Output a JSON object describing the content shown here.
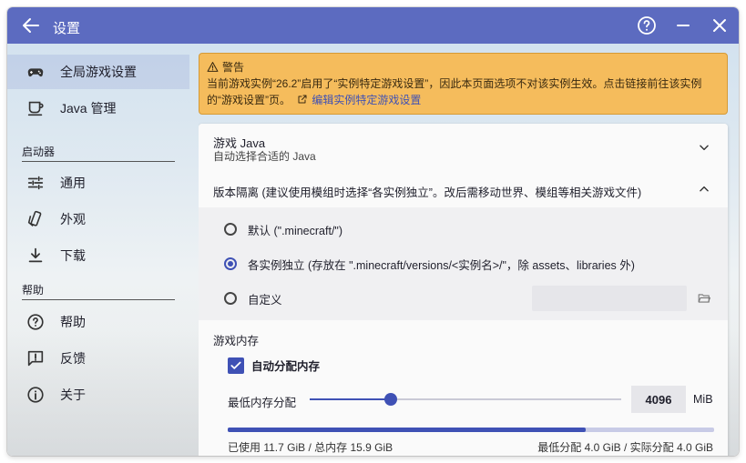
{
  "window": {
    "title": "设置"
  },
  "sidebar": {
    "items": [
      {
        "label": "全局游戏设置",
        "icon": "gamepad-icon"
      },
      {
        "label": "Java 管理",
        "icon": "cup-icon"
      }
    ],
    "sections": [
      {
        "title": "启动器",
        "items": [
          {
            "label": "通用",
            "icon": "sliders-icon"
          },
          {
            "label": "外观",
            "icon": "palette-icon"
          },
          {
            "label": "下载",
            "icon": "download-icon"
          }
        ]
      },
      {
        "title": "帮助",
        "items": [
          {
            "label": "帮助",
            "icon": "help-icon"
          },
          {
            "label": "反馈",
            "icon": "feedback-icon"
          },
          {
            "label": "关于",
            "icon": "info-icon"
          }
        ]
      }
    ]
  },
  "warning": {
    "title": "警告",
    "body": "当前游戏实例“26.2”启用了“实例特定游戏设置”，因此本页面选项不对该实例生效。点击链接前往该实例的“游戏设置”页。",
    "link": "编辑实例特定游戏设置"
  },
  "java": {
    "title": "游戏 Java",
    "subtitle": "自动选择合适的 Java"
  },
  "isolation": {
    "title": "版本隔离 (建议使用模组时选择“各实例独立”。改后需移动世界、模组等相关游戏文件)",
    "options": [
      {
        "label": "默认 (\".minecraft/\")",
        "selected": false
      },
      {
        "label": "各实例独立 (存放在 \".minecraft/versions/<实例名>/\"，除 assets、libraries 外)",
        "selected": true
      },
      {
        "label": "自定义",
        "selected": false
      }
    ]
  },
  "memory": {
    "title": "游戏内存",
    "auto_label": "自动分配内存",
    "auto_checked": true,
    "min_label": "最低内存分配",
    "min_value": "4096",
    "slider_fraction": 0.26,
    "unit": "MiB",
    "usage_fraction": 0.736,
    "usage_left": "已使用 11.7 GiB / 总内存 15.9 GiB",
    "usage_right": "最低分配 4.0 GiB / 实际分配 4.0 GiB"
  },
  "colors": {
    "accent": "#5c6bc0",
    "primary": "#3f51b5",
    "warning": "#f5bc5c"
  }
}
